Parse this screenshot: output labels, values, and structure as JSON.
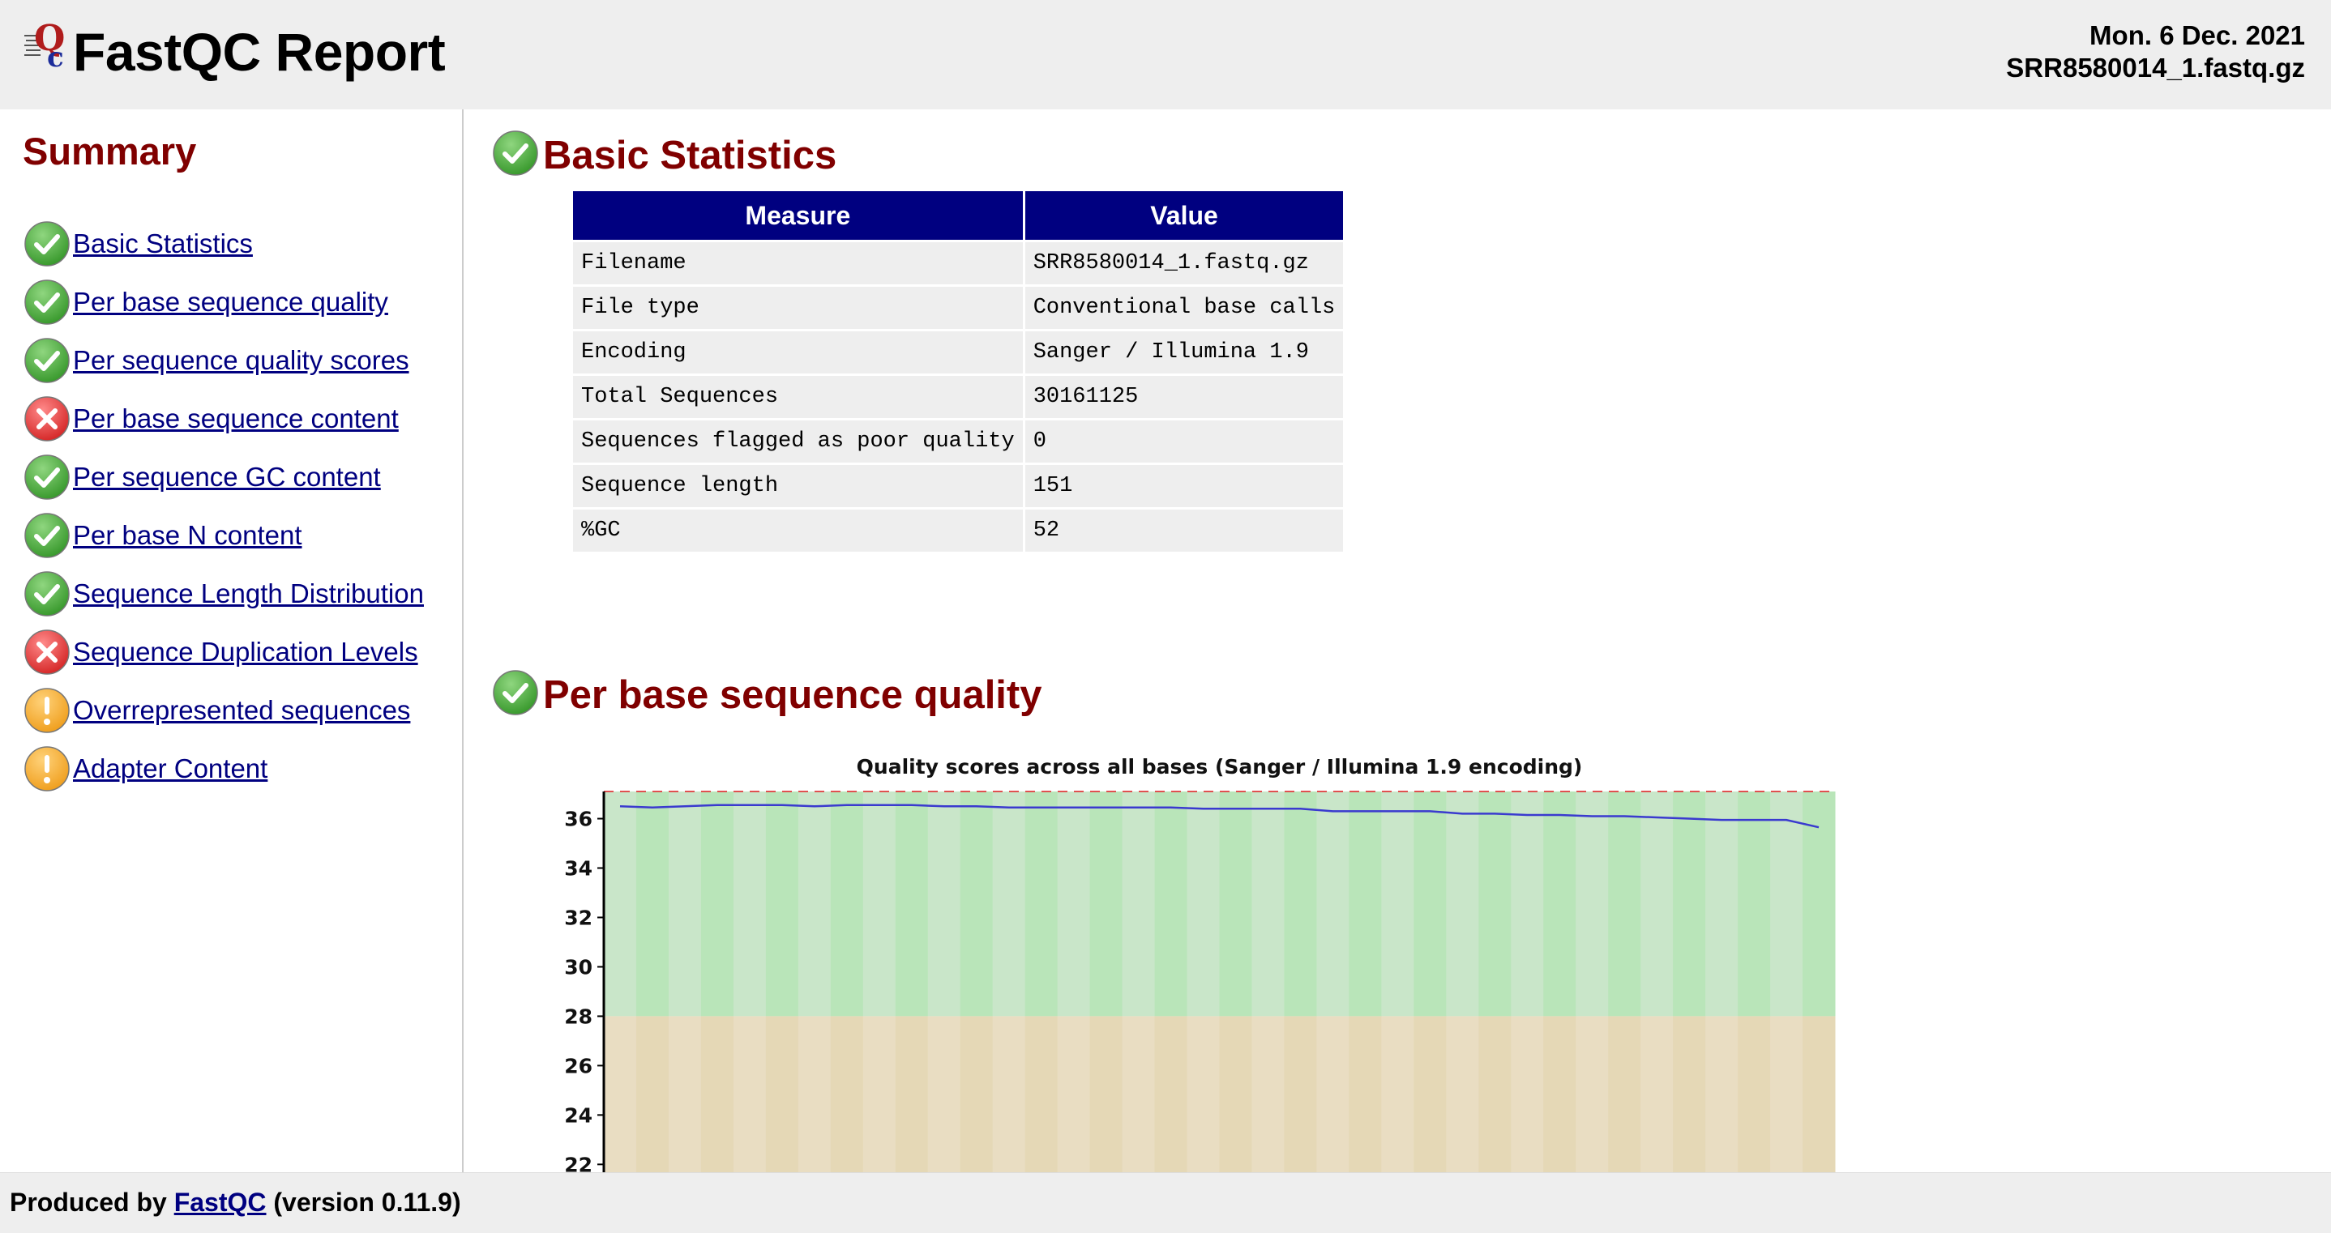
{
  "header": {
    "title": "FastQC Report",
    "date": "Mon. 6 Dec. 2021",
    "filename": "SRR8580014_1.fastq.gz"
  },
  "sidebar": {
    "title": "Summary",
    "items": [
      {
        "label": "Basic Statistics",
        "status": "pass"
      },
      {
        "label": "Per base sequence quality",
        "status": "pass"
      },
      {
        "label": "Per sequence quality scores",
        "status": "pass"
      },
      {
        "label": "Per base sequence content",
        "status": "fail"
      },
      {
        "label": "Per sequence GC content",
        "status": "pass"
      },
      {
        "label": "Per base N content",
        "status": "pass"
      },
      {
        "label": "Sequence Length Distribution",
        "status": "pass"
      },
      {
        "label": "Sequence Duplication Levels",
        "status": "fail"
      },
      {
        "label": "Overrepresented sequences",
        "status": "warn"
      },
      {
        "label": "Adapter Content",
        "status": "warn"
      }
    ]
  },
  "basic_stats": {
    "title": "Basic Statistics",
    "headers": [
      "Measure",
      "Value"
    ],
    "rows": [
      [
        "Filename",
        "SRR8580014_1.fastq.gz"
      ],
      [
        "File type",
        "Conventional base calls"
      ],
      [
        "Encoding",
        "Sanger / Illumina 1.9"
      ],
      [
        "Total Sequences",
        "30161125"
      ],
      [
        "Sequences flagged as poor quality",
        "0"
      ],
      [
        "Sequence length",
        "151"
      ],
      [
        "%GC",
        "52"
      ]
    ]
  },
  "quality_section": {
    "title": "Per base sequence quality"
  },
  "chart_data": {
    "type": "line",
    "title": "Quality scores across all bases (Sanger / Illumina 1.9 encoding)",
    "yticks": [
      36,
      34,
      32,
      30,
      28,
      26,
      24,
      22
    ],
    "ylim": [
      20.6,
      37.1
    ],
    "num_bins": 38,
    "zones": [
      {
        "name": "good",
        "from": 28,
        "to": 37.1,
        "colors": [
          "#c9e6c9",
          "#b9e5b9"
        ]
      },
      {
        "name": "reasonable",
        "from": 20.6,
        "to": 28,
        "colors": [
          "#e9ddc2",
          "#e5d8b6"
        ]
      }
    ],
    "mean_line_color": "#3a3acf",
    "series": [
      {
        "values": [
          36.5,
          36.45,
          36.5,
          36.55,
          36.55,
          36.55,
          36.5,
          36.55,
          36.55,
          36.55,
          36.5,
          36.5,
          36.45,
          36.45,
          36.45,
          36.45,
          36.45,
          36.45,
          36.4,
          36.4,
          36.4,
          36.4,
          36.3,
          36.3,
          36.3,
          36.3,
          36.2,
          36.2,
          36.15,
          36.15,
          36.1,
          36.1,
          36.05,
          36.0,
          35.95,
          35.95,
          35.95,
          35.65
        ]
      }
    ]
  },
  "footer": {
    "prefix": "Produced by",
    "link": "FastQC",
    "suffix": "(version 0.11.9)"
  },
  "colors": {
    "header_bg": "#eeeeee",
    "heading": "#800000",
    "link": "#000080",
    "table_header": "#000080",
    "pass": "#3a9a2e",
    "fail": "#d62a2a",
    "warn": "#f0a020"
  }
}
